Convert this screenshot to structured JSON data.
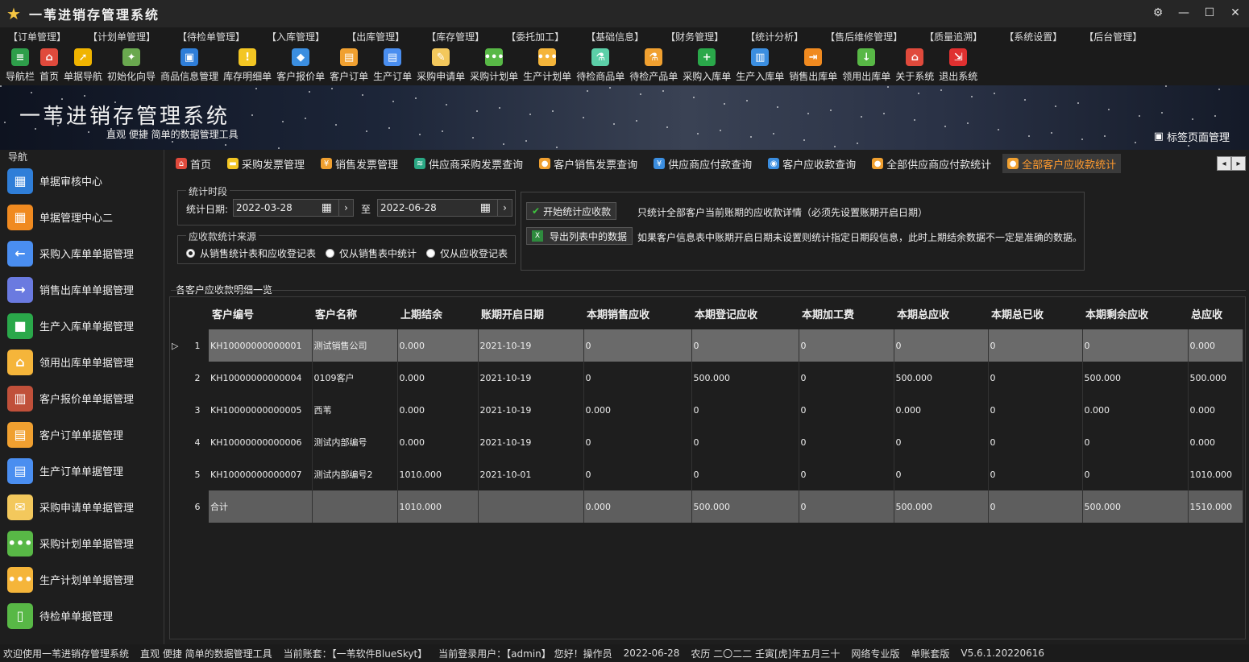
{
  "app": {
    "title": "一苇进销存管理系统"
  },
  "menu": [
    "【订单管理】",
    "【计划单管理】",
    "【待检单管理】",
    "【入库管理】",
    "【出库管理】",
    "【库存管理】",
    "【委托加工】",
    "【基础信息】",
    "【财务管理】",
    "【统计分析】",
    "【售后维修管理】",
    "【质量追溯】",
    "【系统设置】",
    "【后台管理】"
  ],
  "toolbar": [
    {
      "label": "导航栏",
      "icon": "list-icon",
      "color": "#2e9e4a"
    },
    {
      "label": "首页",
      "icon": "home-icon",
      "color": "#e04a3c"
    },
    {
      "label": "单据导航",
      "icon": "compass-icon",
      "color": "#f0b400"
    },
    {
      "label": "初始化向导",
      "icon": "wand-icon",
      "color": "#6aa84f"
    },
    {
      "label": "商品信息管理",
      "icon": "cubes-icon",
      "color": "#2f7ed8"
    },
    {
      "label": "库存明细单",
      "icon": "warning-icon",
      "color": "#f3c623"
    },
    {
      "label": "客户报价单",
      "icon": "tag-icon",
      "color": "#3b8ee0"
    },
    {
      "label": "客户订单",
      "icon": "doc-icon",
      "color": "#f0a030"
    },
    {
      "label": "生产订单",
      "icon": "doc-icon",
      "color": "#4a8ef0"
    },
    {
      "label": "采购申请单",
      "icon": "note-icon",
      "color": "#f3c85c"
    },
    {
      "label": "采购计划单",
      "icon": "dots-icon",
      "color": "#58b846"
    },
    {
      "label": "生产计划单",
      "icon": "dots-icon",
      "color": "#f5b53a"
    },
    {
      "label": "待检商品单",
      "icon": "flask-icon",
      "color": "#5ccfa8"
    },
    {
      "label": "待检产品单",
      "icon": "flask-icon",
      "color": "#f0a030"
    },
    {
      "label": "采购入库单",
      "icon": "plus-icon",
      "color": "#2aa84a"
    },
    {
      "label": "生产入库单",
      "icon": "cart-icon",
      "color": "#3b8ee0"
    },
    {
      "label": "销售出库单",
      "icon": "exit-icon",
      "color": "#f08a20"
    },
    {
      "label": "领用出库单",
      "icon": "download-icon",
      "color": "#58b846"
    },
    {
      "label": "关于系统",
      "icon": "house-icon",
      "color": "#e04a3c"
    },
    {
      "label": "退出系统",
      "icon": "logout-icon",
      "color": "#e03030"
    }
  ],
  "banner": {
    "title": "一苇进销存管理系统",
    "subtitle": "直观 便捷 简单的数据管理工具",
    "tab_manage": "标签页面管理"
  },
  "sidebar": {
    "title": "导航",
    "items": [
      {
        "label": "单据审核中心",
        "icon": "grid-icon",
        "color": "#2f7ed8"
      },
      {
        "label": "单据管理中心二",
        "icon": "grid-icon",
        "color": "#f08a20"
      },
      {
        "label": "采购入库单单据管理",
        "icon": "arrow-left-icon",
        "color": "#4a8ef0"
      },
      {
        "label": "销售出库单单据管理",
        "icon": "arrow-right-icon",
        "color": "#6a7ae0"
      },
      {
        "label": "生产入库单单据管理",
        "icon": "box-icon",
        "color": "#2aa84a"
      },
      {
        "label": "领用出库单单据管理",
        "icon": "house-icon",
        "color": "#f5b53a"
      },
      {
        "label": "客户报价单单据管理",
        "icon": "books-icon",
        "color": "#c0503a"
      },
      {
        "label": "客户订单单据管理",
        "icon": "doc-icon",
        "color": "#f0a030"
      },
      {
        "label": "生产订单单据管理",
        "icon": "doc-icon",
        "color": "#4a8ef0"
      },
      {
        "label": "采购申请单单据管理",
        "icon": "envelope-icon",
        "color": "#f3c85c"
      },
      {
        "label": "采购计划单单据管理",
        "icon": "dots-icon",
        "color": "#58b846"
      },
      {
        "label": "生产计划单单据管理",
        "icon": "dots-icon",
        "color": "#f5b53a"
      },
      {
        "label": "待检单单据管理",
        "icon": "page-icon",
        "color": "#58b846"
      }
    ]
  },
  "tabs": [
    {
      "label": "首页",
      "icon": "home-icon",
      "color": "#e04a3c",
      "active": false
    },
    {
      "label": "采购发票管理",
      "icon": "folder-icon",
      "color": "#f3c623",
      "active": false
    },
    {
      "label": "销售发票管理",
      "icon": "invoice-icon",
      "color": "#f0a030",
      "active": false
    },
    {
      "label": "供应商采购发票查询",
      "icon": "stack-icon",
      "color": "#2aa884",
      "active": false
    },
    {
      "label": "客户销售发票查询",
      "icon": "coin-icon",
      "color": "#f0a030",
      "active": false
    },
    {
      "label": "供应商应付款查询",
      "icon": "yen-icon",
      "color": "#3b8ee0",
      "active": false
    },
    {
      "label": "客户应收款查询",
      "icon": "bag-icon",
      "color": "#3b8ee0",
      "active": false
    },
    {
      "label": "全部供应商应付款统计",
      "icon": "coin-icon",
      "color": "#f0a030",
      "active": false
    },
    {
      "label": "全部客户应收款统计",
      "icon": "coin-icon",
      "color": "#f0a030",
      "active": true
    }
  ],
  "period": {
    "title": "统计时段",
    "date_label": "统计日期:",
    "start": "2022-03-28",
    "to": "至",
    "end": "2022-06-28"
  },
  "source": {
    "title": "应收款统计来源",
    "options": [
      "从销售统计表和应收登记表",
      "仅从销售表中统计",
      "仅从应收登记表"
    ],
    "selected": 0
  },
  "actions": {
    "start_btn": "开始统计应收款",
    "start_note": "只统计全部客户当前账期的应收款详情（必须先设置账期开启日期）",
    "export_btn": "导出列表中的数据",
    "export_note": "如果客户信息表中账期开启日期未设置则统计指定日期段信息，此时上期结余数据不一定是准确的数据。"
  },
  "grid": {
    "title": "各客户应收款明细一览",
    "columns": [
      "客户编号",
      "客户名称",
      "上期结余",
      "账期开启日期",
      "本期销售应收",
      "本期登记应收",
      "本期加工费",
      "本期总应收",
      "本期总已收",
      "本期剩余应收",
      "总应收"
    ],
    "rows": [
      {
        "n": "1",
        "cells": [
          "KH10000000000001",
          "测试销售公司",
          "0.000",
          "2021-10-19",
          "0",
          "0",
          "0",
          "0",
          "0",
          "0",
          "0.000"
        ]
      },
      {
        "n": "2",
        "cells": [
          "KH10000000000004",
          "0109客户",
          "0.000",
          "2021-10-19",
          "0",
          "500.000",
          "0",
          "500.000",
          "0",
          "500.000",
          "500.000"
        ]
      },
      {
        "n": "3",
        "cells": [
          "KH10000000000005",
          "西苇",
          "0.000",
          "2021-10-19",
          "0.000",
          "0",
          "0",
          "0.000",
          "0",
          "0.000",
          "0.000"
        ]
      },
      {
        "n": "4",
        "cells": [
          "KH10000000000006",
          "测试内部编号",
          "0.000",
          "2021-10-19",
          "0",
          "0",
          "0",
          "0",
          "0",
          "0",
          "0.000"
        ]
      },
      {
        "n": "5",
        "cells": [
          "KH10000000000007",
          "测试内部编号2",
          "1010.000",
          "2021-10-01",
          "0",
          "0",
          "0",
          "0",
          "0",
          "0",
          "1010.000"
        ]
      },
      {
        "n": "6",
        "cells": [
          "合计",
          "",
          "1010.000",
          "",
          "0.000",
          "500.000",
          "0",
          "500.000",
          "0",
          "500.000",
          "1510.000"
        ]
      }
    ]
  },
  "status": [
    "欢迎使用一苇进销存管理系统",
    "直观 便捷 简单的数据管理工具",
    "当前账套：【一苇软件BlueSkyt】",
    "当前登录用户：【admin】 您好！操作员",
    "2022-06-28",
    "农历 二〇二二 壬寅[虎]年五月三十",
    "网络专业版",
    "单账套版",
    "V5.6.1.20220616"
  ]
}
